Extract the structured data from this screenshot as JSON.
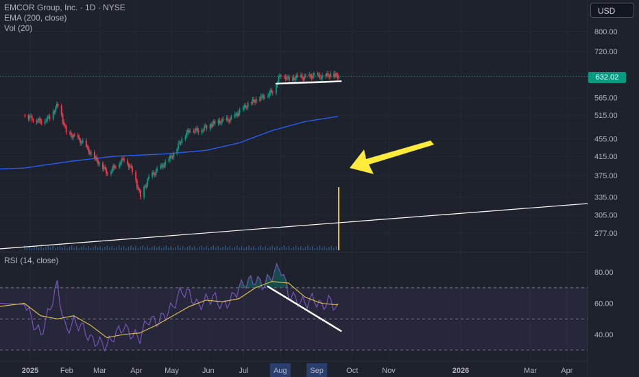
{
  "header": {
    "symbol_line": "EMCOR Group, Inc. · 1D · NYSE",
    "ema_label": "EMA (200, close)",
    "vol_label": "Vol (20)",
    "rsi_label": "RSI (14, close)",
    "currency_button": "USD"
  },
  "price_label": {
    "value": "632.02",
    "color": "#089981"
  },
  "colors": {
    "background": "#1e222d",
    "up": "#089981",
    "down": "#f23645",
    "ema": "#2962ff",
    "rsi": "#7e57c2",
    "rsi_ma": "#e6c84a",
    "arrow": "#ffeb3b",
    "volume_spike": "#e6c84a"
  },
  "chart_data": [
    {
      "type": "candlestick",
      "title": "EMCOR Group, Inc. · 1D · NYSE",
      "y_ticks": [
        "800.00",
        "720.00",
        "632.02",
        "565.00",
        "515.00",
        "455.00",
        "415.00",
        "375.00",
        "335.00",
        "305.00",
        "277.00"
      ],
      "x_ticks": [
        "2025",
        "Feb",
        "Mar",
        "Apr",
        "May",
        "Jun",
        "Jul",
        "Aug",
        "Sep",
        "Oct",
        "Nov",
        "2026",
        "Mar",
        "Apr"
      ],
      "highlighted_x_ticks": [
        "Aug",
        "Sep"
      ],
      "last_price": 632.02,
      "series": [
        {
          "name": "Close (approx.)",
          "points": [
            [
              "2024-12-27",
              515
            ],
            [
              "2025-01-03",
              505
            ],
            [
              "2025-01-10",
              498
            ],
            [
              "2025-01-17",
              510
            ],
            [
              "2025-01-24",
              545
            ],
            [
              "2025-01-31",
              470
            ],
            [
              "2025-02-07",
              460
            ],
            [
              "2025-02-14",
              445
            ],
            [
              "2025-02-21",
              420
            ],
            [
              "2025-02-28",
              400
            ],
            [
              "2025-03-07",
              380
            ],
            [
              "2025-03-14",
              395
            ],
            [
              "2025-03-21",
              410
            ],
            [
              "2025-03-28",
              385
            ],
            [
              "2025-04-04",
              335
            ],
            [
              "2025-04-11",
              370
            ],
            [
              "2025-04-18",
              385
            ],
            [
              "2025-04-25",
              400
            ],
            [
              "2025-05-02",
              420
            ],
            [
              "2025-05-09",
              455
            ],
            [
              "2025-05-16",
              478
            ],
            [
              "2025-05-23",
              475
            ],
            [
              "2025-05-30",
              485
            ],
            [
              "2025-06-06",
              495
            ],
            [
              "2025-06-13",
              500
            ],
            [
              "2025-06-20",
              505
            ],
            [
              "2025-06-27",
              525
            ],
            [
              "2025-07-04",
              545
            ],
            [
              "2025-07-11",
              560
            ],
            [
              "2025-07-18",
              570
            ],
            [
              "2025-07-25",
              585
            ],
            [
              "2025-08-01",
              640
            ],
            [
              "2025-08-08",
              622
            ],
            [
              "2025-08-15",
              630
            ],
            [
              "2025-08-22",
              628
            ],
            [
              "2025-08-29",
              635
            ],
            [
              "2025-09-05",
              630
            ],
            [
              "2025-09-12",
              638
            ],
            [
              "2025-09-19",
              632.02
            ]
          ]
        },
        {
          "name": "EMA (200, close)",
          "points": [
            [
              "2024-12-27",
              390
            ],
            [
              "2025-02-07",
              405
            ],
            [
              "2025-03-14",
              415
            ],
            [
              "2025-04-25",
              420
            ],
            [
              "2025-05-30",
              428
            ],
            [
              "2025-06-27",
              445
            ],
            [
              "2025-07-25",
              475
            ],
            [
              "2025-08-22",
              498
            ],
            [
              "2025-09-19",
              512
            ]
          ]
        }
      ],
      "annotations": [
        {
          "kind": "support-line",
          "from": [
            "2025-07-28",
            608
          ],
          "to": [
            "2025-09-22",
            616
          ]
        },
        {
          "kind": "arrow",
          "pointing_to": "volume spike"
        }
      ]
    },
    {
      "type": "bar",
      "title": "Vol (20)",
      "note": "small uniform volume bars with a single large spike on the last session",
      "spike_date": "2025-09-19"
    },
    {
      "type": "line",
      "title": "RSI (14, close)",
      "y_ticks": [
        "80.00",
        "60.00",
        "40.00"
      ],
      "band": [
        30,
        70
      ],
      "series": [
        {
          "name": "RSI",
          "points": [
            [
              "2024-12-27",
              62
            ],
            [
              "2025-01-03",
              48
            ],
            [
              "2025-01-10",
              40
            ],
            [
              "2025-01-17",
              55
            ],
            [
              "2025-01-24",
              72
            ],
            [
              "2025-01-31",
              42
            ],
            [
              "2025-02-07",
              48
            ],
            [
              "2025-02-14",
              45
            ],
            [
              "2025-02-21",
              37
            ],
            [
              "2025-02-28",
              35
            ],
            [
              "2025-03-07",
              33
            ],
            [
              "2025-03-14",
              40
            ],
            [
              "2025-03-21",
              45
            ],
            [
              "2025-03-28",
              40
            ],
            [
              "2025-04-04",
              38
            ],
            [
              "2025-04-11",
              50
            ],
            [
              "2025-04-18",
              48
            ],
            [
              "2025-04-25",
              52
            ],
            [
              "2025-05-02",
              58
            ],
            [
              "2025-05-09",
              68
            ],
            [
              "2025-05-16",
              66
            ],
            [
              "2025-05-23",
              58
            ],
            [
              "2025-05-30",
              62
            ],
            [
              "2025-06-06",
              64
            ],
            [
              "2025-06-13",
              58
            ],
            [
              "2025-06-20",
              62
            ],
            [
              "2025-06-27",
              70
            ],
            [
              "2025-07-04",
              74
            ],
            [
              "2025-07-11",
              75
            ],
            [
              "2025-07-18",
              72
            ],
            [
              "2025-07-25",
              78
            ],
            [
              "2025-08-01",
              84
            ],
            [
              "2025-08-08",
              66
            ],
            [
              "2025-08-15",
              62
            ],
            [
              "2025-08-22",
              60
            ],
            [
              "2025-08-29",
              63
            ],
            [
              "2025-09-05",
              58
            ],
            [
              "2025-09-12",
              62
            ],
            [
              "2025-09-19",
              56
            ]
          ]
        },
        {
          "name": "RSI MA",
          "points": [
            [
              "2024-12-27",
              60
            ],
            [
              "2025-01-10",
              52
            ],
            [
              "2025-01-24",
              50
            ],
            [
              "2025-02-07",
              52
            ],
            [
              "2025-02-21",
              46
            ],
            [
              "2025-03-07",
              38
            ],
            [
              "2025-03-21",
              40
            ],
            [
              "2025-04-04",
              41
            ],
            [
              "2025-04-18",
              46
            ],
            [
              "2025-05-02",
              52
            ],
            [
              "2025-05-16",
              58
            ],
            [
              "2025-05-30",
              62
            ],
            [
              "2025-06-13",
              61
            ],
            [
              "2025-06-27",
              63
            ],
            [
              "2025-07-11",
              70
            ],
            [
              "2025-07-25",
              74
            ],
            [
              "2025-08-08",
              73
            ],
            [
              "2025-08-22",
              64
            ],
            [
              "2025-09-05",
              60
            ],
            [
              "2025-09-19",
              59
            ]
          ]
        }
      ],
      "annotations": [
        {
          "kind": "divergence-line",
          "from": [
            "2025-07-21",
            71
          ],
          "to": [
            "2025-09-22",
            42
          ]
        }
      ]
    }
  ]
}
